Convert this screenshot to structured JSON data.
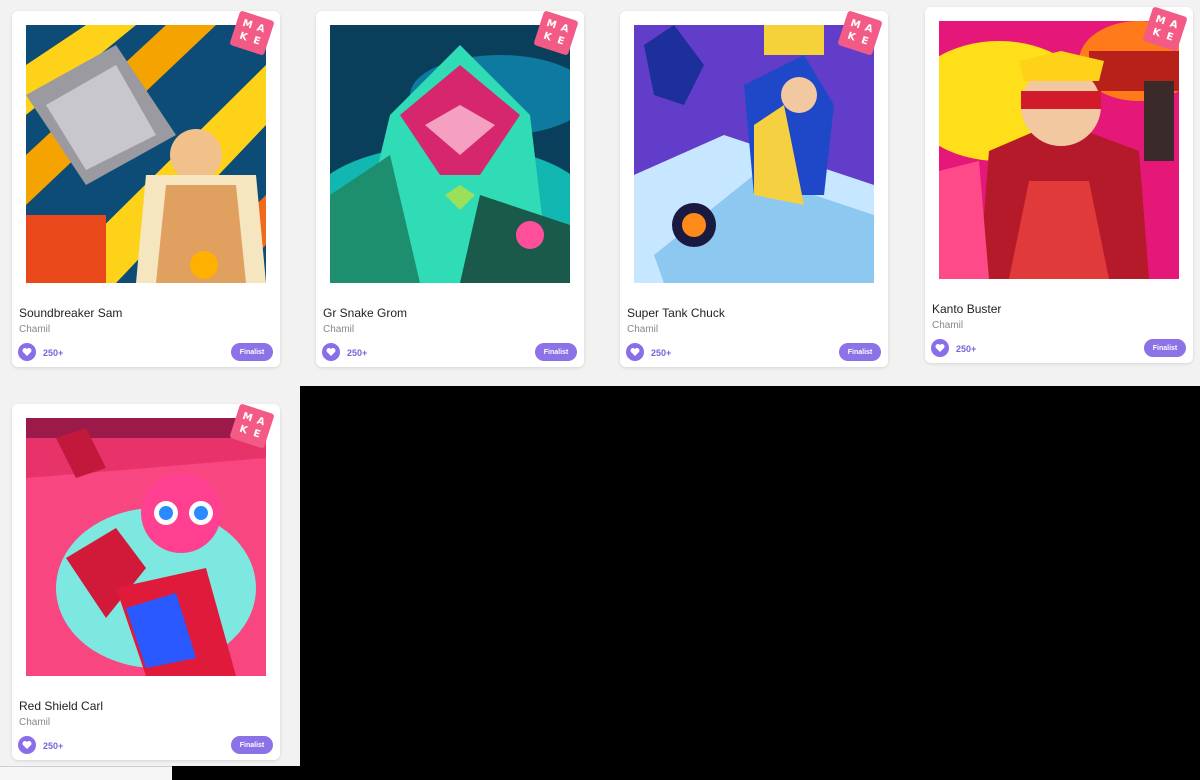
{
  "badge_letters": [
    "M",
    "A",
    "K",
    "E"
  ],
  "cards": [
    {
      "title": "Soundbreaker Sam",
      "author": "Chamil",
      "likes": "250+",
      "tag": "Finalist"
    },
    {
      "title": "Gr Snake Grom",
      "author": "Chamil",
      "likes": "250+",
      "tag": "Finalist"
    },
    {
      "title": "Super Tank Chuck",
      "author": "Chamil",
      "likes": "250+",
      "tag": "Finalist"
    },
    {
      "title": "Kanto Buster",
      "author": "Chamil",
      "likes": "250+",
      "tag": "Finalist"
    },
    {
      "title": "Red Shield Carl",
      "author": "Chamil",
      "likes": "250+",
      "tag": "Finalist"
    }
  ],
  "colors": {
    "accent": "#8b72e6",
    "badge": "#f35b86"
  },
  "icons": {
    "like": "heart-icon",
    "badge": "make-badge-icon"
  }
}
